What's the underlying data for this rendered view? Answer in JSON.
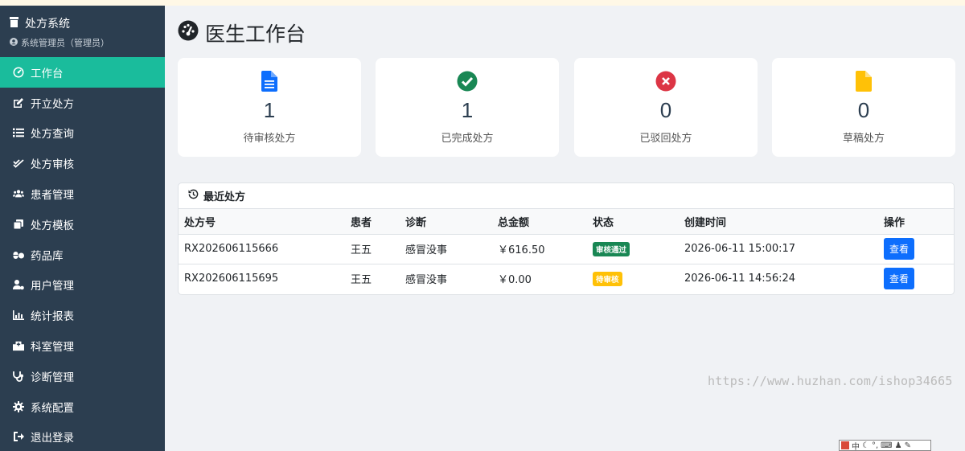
{
  "brand": {
    "title": "处方系统",
    "subtitle": "系统管理员（管理员）"
  },
  "sidebar": {
    "items": [
      {
        "label": "工作台",
        "icon": "dashboard-icon",
        "active": true
      },
      {
        "label": "开立处方",
        "icon": "edit-icon"
      },
      {
        "label": "处方查询",
        "icon": "list-icon"
      },
      {
        "label": "处方审核",
        "icon": "check-double-icon"
      },
      {
        "label": "患者管理",
        "icon": "users-icon"
      },
      {
        "label": "处方模板",
        "icon": "copy-icon"
      },
      {
        "label": "药品库",
        "icon": "pills-icon"
      },
      {
        "label": "用户管理",
        "icon": "user-cog-icon"
      },
      {
        "label": "统计报表",
        "icon": "chart-icon"
      },
      {
        "label": "科室管理",
        "icon": "hospital-icon"
      },
      {
        "label": "诊断管理",
        "icon": "stethoscope-icon"
      },
      {
        "label": "系统配置",
        "icon": "gear-icon"
      },
      {
        "label": "退出登录",
        "icon": "logout-icon"
      }
    ]
  },
  "page": {
    "title": "医生工作台"
  },
  "stats": [
    {
      "value": "1",
      "label": "待审核处方",
      "icon": "file-icon",
      "color": "#0d6efd"
    },
    {
      "value": "1",
      "label": "已完成处方",
      "icon": "check-circle-icon",
      "color": "#198754"
    },
    {
      "value": "0",
      "label": "已驳回处方",
      "icon": "x-circle-icon",
      "color": "#dc3545"
    },
    {
      "value": "0",
      "label": "草稿处方",
      "icon": "draft-icon",
      "color": "#ffc107"
    }
  ],
  "recent": {
    "title": "最近处方",
    "columns": [
      "处方号",
      "患者",
      "诊断",
      "总金额",
      "状态",
      "创建时间",
      "操作"
    ],
    "rows": [
      {
        "id": "RX202606115666",
        "patient": "王五",
        "diagnosis": "感冒没事",
        "amount": "￥616.50",
        "status": "审核通过",
        "status_color": "#198754",
        "created": "2026-06-11 15:00:17",
        "action": "查看"
      },
      {
        "id": "RX202606115695",
        "patient": "王五",
        "diagnosis": "感冒没事",
        "amount": "￥0.00",
        "status": "待审核",
        "status_color": "#ffc107",
        "created": "2026-06-11 14:56:24",
        "action": "查看"
      }
    ]
  },
  "watermark": "https://www.huzhan.com/ishop34665",
  "ime": {
    "lang": "中"
  }
}
